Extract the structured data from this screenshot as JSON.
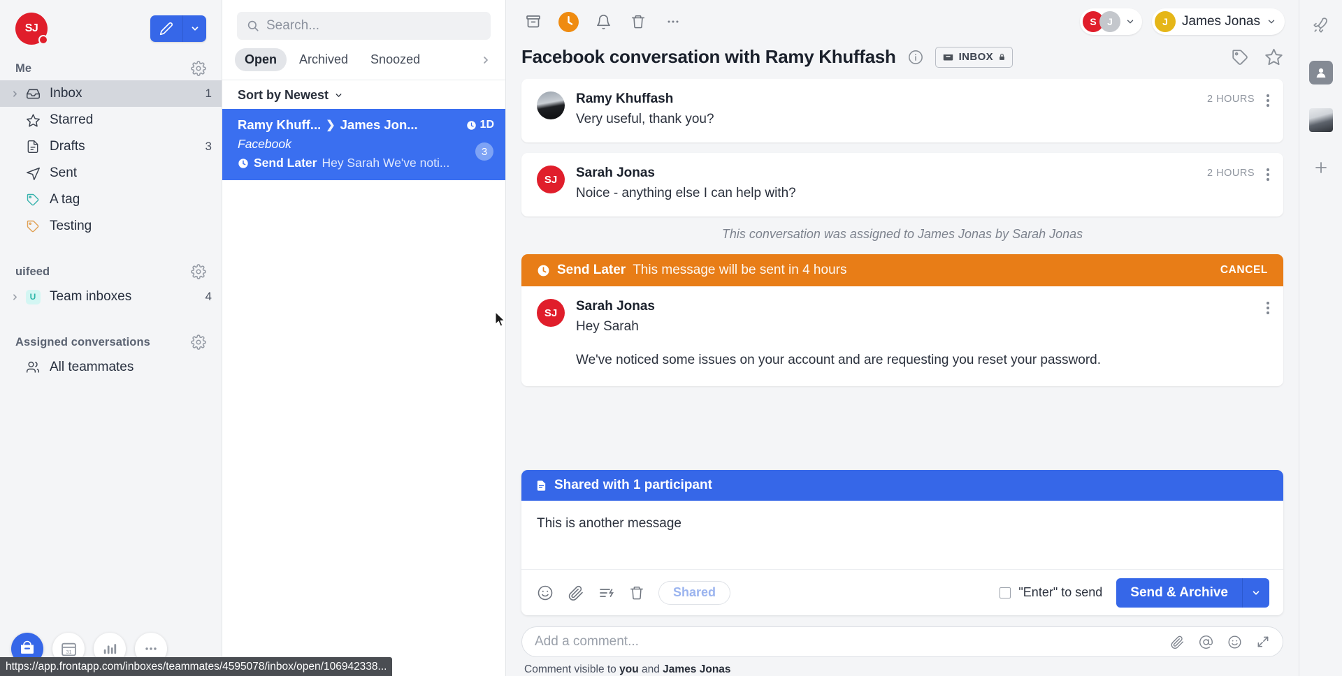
{
  "sidebar": {
    "logo_initials": "SJ",
    "sections": [
      {
        "label": "Me"
      },
      {
        "label": "uifeed"
      },
      {
        "label": "Assigned conversations"
      }
    ],
    "me_items": [
      {
        "label": "Inbox",
        "count": "1",
        "icon": "inbox-icon",
        "active": true,
        "expandable": true
      },
      {
        "label": "Starred",
        "count": "",
        "icon": "star-icon",
        "active": false,
        "expandable": false
      },
      {
        "label": "Drafts",
        "count": "3",
        "icon": "draft-icon",
        "active": false,
        "expandable": false
      },
      {
        "label": "Sent",
        "count": "",
        "icon": "sent-icon",
        "active": false,
        "expandable": false
      },
      {
        "label": "A tag",
        "count": "",
        "icon": "tag-icon",
        "active": false,
        "expandable": false
      },
      {
        "label": "Testing",
        "count": "",
        "icon": "tag-icon",
        "active": false,
        "expandable": false
      }
    ],
    "team_item": {
      "label": "Team inboxes",
      "count": "4",
      "badge": "U"
    },
    "assigned_item": {
      "label": "All teammates"
    },
    "dock": [
      {
        "name": "inbox-dock-icon"
      },
      {
        "name": "calendar-dock-icon",
        "label": "31"
      },
      {
        "name": "analytics-dock-icon"
      },
      {
        "name": "more-dock-icon"
      }
    ]
  },
  "statusbar": {
    "url": "https://app.frontapp.com/inboxes/teammates/4595078/inbox/open/106942338..."
  },
  "convlist": {
    "search_placeholder": "Search...",
    "filters": [
      {
        "label": "Open",
        "active": true
      },
      {
        "label": "Archived",
        "active": false
      },
      {
        "label": "Snoozed",
        "active": false
      }
    ],
    "sort_label": "Sort by Newest",
    "conversation": {
      "from": "Ramy Khuff...",
      "to": "James Jon...",
      "time": "1D",
      "channel": "Facebook",
      "badge": "3",
      "status_label": "Send Later",
      "preview": "Hey Sarah We've noti..."
    }
  },
  "toolbar": {
    "archive_icon": "archive-icon",
    "snooze_icon": "clock-icon",
    "reminder_icon": "bell-icon",
    "trash_icon": "trash-icon",
    "more_icon": "more-icon",
    "assignees": [
      {
        "initial": "S",
        "color": "#e01e2b"
      },
      {
        "initial": "J",
        "color": "#c4c7cc"
      }
    ],
    "user_name": "James Jonas",
    "user_initial": "J"
  },
  "conversation": {
    "title": "Facebook conversation with Ramy Khuffash",
    "inbox_chip": "INBOX",
    "info_icon": "info-icon",
    "tag_icon": "tag-icon",
    "star_icon": "star-icon"
  },
  "messages": [
    {
      "author": "Ramy Khuffash",
      "text": "Very useful, thank you?",
      "time": "2 HOURS",
      "avatar_type": "photo",
      "initials": ""
    },
    {
      "author": "Sarah Jonas",
      "text": "Noice - anything else I can help with?",
      "time": "2 HOURS",
      "avatar_type": "initials",
      "initials": "SJ"
    }
  ],
  "system_note": "This conversation was assigned to James Jonas by Sarah Jonas",
  "send_later": {
    "title": "Send Later",
    "subtitle": "This message will be sent in 4 hours",
    "cancel_label": "CANCEL",
    "author": "Sarah Jonas",
    "initials": "SJ",
    "greeting": "Hey Sarah",
    "body": "We've noticed some issues on your account and are requesting you reset your password."
  },
  "composer": {
    "header": "Shared with 1 participant",
    "draft_text": "This is another message",
    "tools": [
      {
        "name": "emoji-icon"
      },
      {
        "name": "attachment-icon"
      },
      {
        "name": "template-icon"
      },
      {
        "name": "delete-draft-icon"
      }
    ],
    "shared_chip": "Shared",
    "enter_to_send": "\"Enter\" to send",
    "send_label": "Send & Archive"
  },
  "comment": {
    "placeholder": "Add a comment...",
    "note_prefix": "Comment visible to ",
    "note_you": "you",
    "note_and": " and ",
    "note_user": "James Jonas",
    "icons": [
      {
        "name": "attachment-icon"
      },
      {
        "name": "mention-icon"
      },
      {
        "name": "emoji-icon"
      },
      {
        "name": "expand-icon"
      }
    ]
  },
  "rail": [
    {
      "name": "rocket-icon"
    },
    {
      "name": "contact-icon"
    },
    {
      "name": "person-photo-icon"
    },
    {
      "name": "add-plugin-icon"
    }
  ],
  "colors": {
    "accent_blue": "#3667e8",
    "selected_blue": "#3a6ff0",
    "orange": "#e87d17",
    "red_avatar": "#e01e2b",
    "gold_avatar": "#e5b618"
  }
}
